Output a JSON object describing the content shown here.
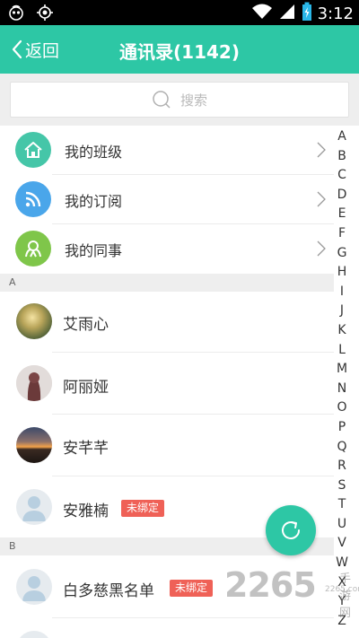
{
  "status_bar": {
    "time": "3:12"
  },
  "header": {
    "back_label": "返回",
    "title": "通讯录(1142)"
  },
  "search": {
    "placeholder": "搜索"
  },
  "entries": [
    {
      "label": "我的班级",
      "icon": "home-icon",
      "color": "#45c6a8"
    },
    {
      "label": "我的订阅",
      "icon": "rss-icon",
      "color": "#4aa6ea"
    },
    {
      "label": "我的同事",
      "icon": "colleague-icon",
      "color": "#7fc64a"
    }
  ],
  "sections": [
    {
      "letter": "A"
    },
    {
      "letter": "B"
    }
  ],
  "contacts": [
    {
      "name": "艾雨心",
      "badge": ""
    },
    {
      "name": "阿丽娅",
      "badge": ""
    },
    {
      "name": "安芊芊",
      "badge": ""
    },
    {
      "name": "安雅楠",
      "badge": "未绑定"
    },
    {
      "name": "白多慈黑名单",
      "badge": "未绑定"
    }
  ],
  "alphabet": [
    "A",
    "B",
    "C",
    "D",
    "E",
    "F",
    "G",
    "H",
    "I",
    "J",
    "K",
    "L",
    "M",
    "N",
    "O",
    "P",
    "Q",
    "R",
    "S",
    "T",
    "U",
    "V",
    "W",
    "X",
    "Y",
    "Z"
  ],
  "watermark": {
    "number": "2265",
    "site": "手游网",
    "url": "2265.com"
  },
  "colors": {
    "accent": "#2dc7a5",
    "badge": "#ef6157",
    "section_bg": "#eeeeee"
  }
}
